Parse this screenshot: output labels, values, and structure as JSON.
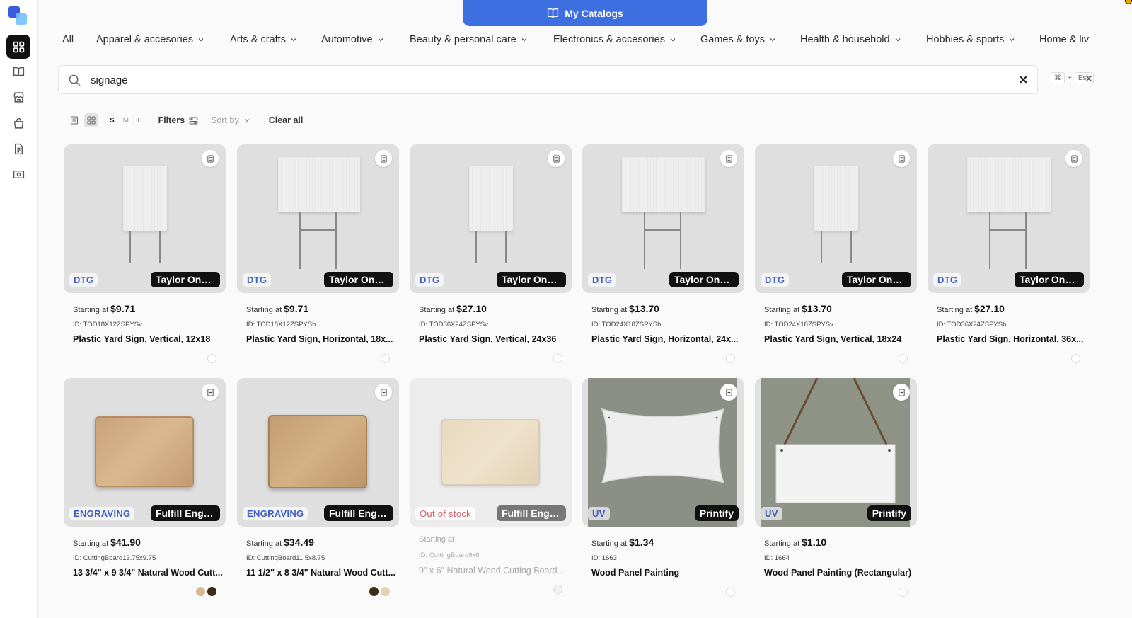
{
  "header": {
    "my_catalogs": "My Catalogs"
  },
  "categories": [
    {
      "label": "All",
      "dropdown": false
    },
    {
      "label": "Apparel & accesories",
      "dropdown": true
    },
    {
      "label": "Arts & crafts",
      "dropdown": true
    },
    {
      "label": "Automotive",
      "dropdown": true
    },
    {
      "label": "Beauty & personal care",
      "dropdown": true
    },
    {
      "label": "Electronics & accesories",
      "dropdown": true
    },
    {
      "label": "Games & toys",
      "dropdown": true
    },
    {
      "label": "Health & household",
      "dropdown": true
    },
    {
      "label": "Hobbies & sports",
      "dropdown": true
    },
    {
      "label": "Home & liv",
      "dropdown": false
    }
  ],
  "search": {
    "value": "signage",
    "shortcut_cmd": "⌘",
    "shortcut_plus": "+",
    "shortcut_esc": "Esc"
  },
  "toolbar": {
    "sizes": [
      "S",
      "M",
      "L"
    ],
    "active_size": "S",
    "filters_label": "Filters",
    "sort_label": "Sort by",
    "clear_label": "Clear all"
  },
  "products": [
    {
      "tech": "DTG",
      "provider": "Taylor OnD...",
      "price_prefix": "Starting at",
      "price": "$9.71",
      "id": "ID: TOD18X12ZSPYSv",
      "name": "Plastic Yard Sign, Vertical, 12x18",
      "image": "sign-vertical"
    },
    {
      "tech": "DTG",
      "provider": "Taylor OnD...",
      "price_prefix": "Starting at",
      "price": "$9.71",
      "id": "ID: TOD18X12ZSPYSh",
      "name": "Plastic Yard Sign, Horizontal, 18x...",
      "image": "sign-horizontal"
    },
    {
      "tech": "DTG",
      "provider": "Taylor OnD...",
      "price_prefix": "Starting at",
      "price": "$27.10",
      "id": "ID: TOD36X24ZSPYSv",
      "name": "Plastic Yard Sign, Vertical, 24x36",
      "image": "sign-vertical"
    },
    {
      "tech": "DTG",
      "provider": "Taylor OnD...",
      "price_prefix": "Starting at",
      "price": "$13.70",
      "id": "ID: TOD24X18ZSPYSh",
      "name": "Plastic Yard Sign, Horizontal, 24x...",
      "image": "sign-horizontal"
    },
    {
      "tech": "DTG",
      "provider": "Taylor OnD...",
      "price_prefix": "Starting at",
      "price": "$13.70",
      "id": "ID: TOD24X18ZSPYSv",
      "name": "Plastic Yard Sign, Vertical, 18x24",
      "image": "sign-vertical"
    },
    {
      "tech": "DTG",
      "provider": "Taylor OnD...",
      "price_prefix": "Starting at",
      "price": "$27.10",
      "id": "ID: TOD36X24ZSPYSh",
      "name": "Plastic Yard Sign, Horizontal, 36x...",
      "image": "sign-horizontal"
    },
    {
      "tech": "ENGRAVING",
      "provider": "Fulfill Engine",
      "price_prefix": "Starting at",
      "price": "$41.90",
      "id": "ID: CuttingBoard13.75x9.75",
      "name": "13 3/4\" x 9 3/4\" Natural Wood Cutt...",
      "image": "board",
      "swatches": [
        "#d9b88d",
        "#3d2a17"
      ]
    },
    {
      "tech": "ENGRAVING",
      "provider": "Fulfill Engine",
      "price_prefix": "Starting at",
      "price": "$34.49",
      "id": "ID: CuttingBoard11.5x8.75",
      "name": "11 1/2\" x 8 3/4\" Natural Wood Cutt...",
      "image": "board",
      "swatches": [
        "#3d2a17",
        "#e6d3ae"
      ]
    },
    {
      "tech": "Out of stock",
      "provider": "Fulfill Engine",
      "price_prefix": "Starting at",
      "price": "",
      "id": "ID: CuttingBoard9x6",
      "name": "9\" x 6\" Natural Wood Cutting Board...",
      "image": "board-light",
      "out_of_stock": true
    },
    {
      "tech": "UV",
      "provider": "Printify",
      "price_prefix": "Starting at",
      "price": "$1.34",
      "id": "ID: 1663",
      "name": "Wood Panel Painting",
      "image": "panel-wavy"
    },
    {
      "tech": "UV",
      "provider": "Printify",
      "price_prefix": "Starting at",
      "price": "$1.10",
      "id": "ID: 1664",
      "name": "Wood Panel Painting (Rectangular)",
      "image": "panel-hanging"
    }
  ],
  "colors": {
    "accent": "#3d6fe0",
    "tech_label": "#3d5ec0",
    "out_of_stock": "#d0616a",
    "provider_badge": "#111111"
  }
}
